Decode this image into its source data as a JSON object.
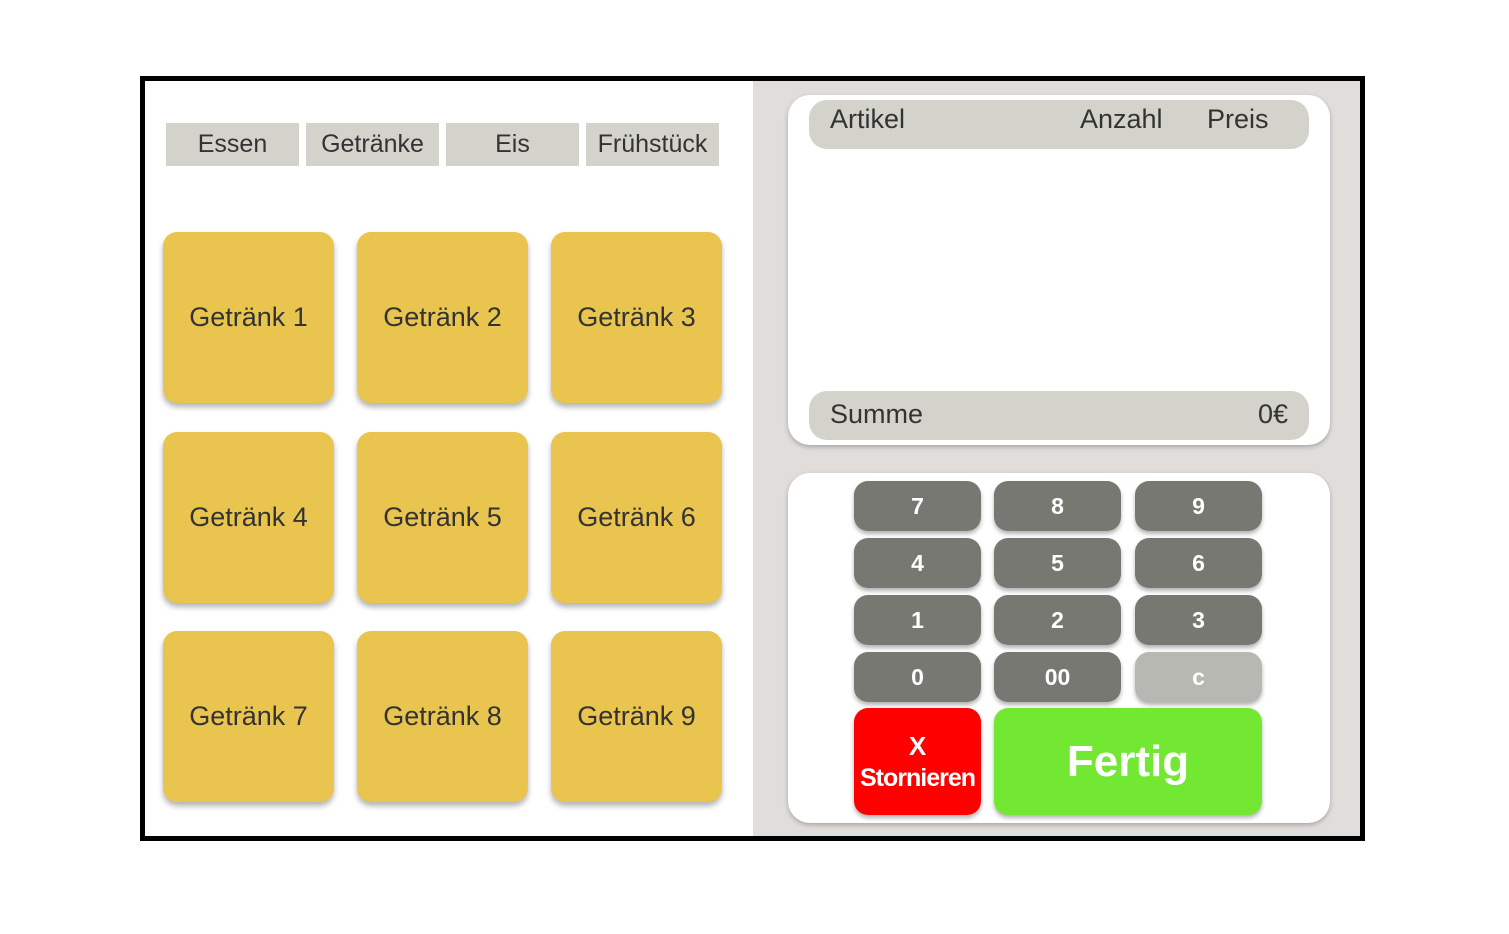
{
  "tabs": [
    "Essen",
    "Getränke",
    "Eis",
    "Frühstück"
  ],
  "products": [
    "Getränk 1",
    "Getränk 2",
    "Getränk 3",
    "Getränk 4",
    "Getränk 5",
    "Getränk 6",
    "Getränk 7",
    "Getränk 8",
    "Getränk 9"
  ],
  "receipt": {
    "col_article": "Artikel",
    "col_qty": "Anzahl",
    "col_price": "Preis",
    "sum_label": "Summe",
    "sum_value": "0€"
  },
  "keypad": {
    "keys": [
      "7",
      "8",
      "9",
      "4",
      "5",
      "6",
      "1",
      "2",
      "3",
      "0",
      "00",
      "c"
    ],
    "cancel_symbol": "X",
    "cancel_label": "Stornieren",
    "done_label": "Fertig"
  },
  "colors": {
    "tile": "#e9c550",
    "key": "#787873",
    "cancel": "#ff0000",
    "done": "#72e832",
    "panel_bg": "#e0dddb"
  }
}
